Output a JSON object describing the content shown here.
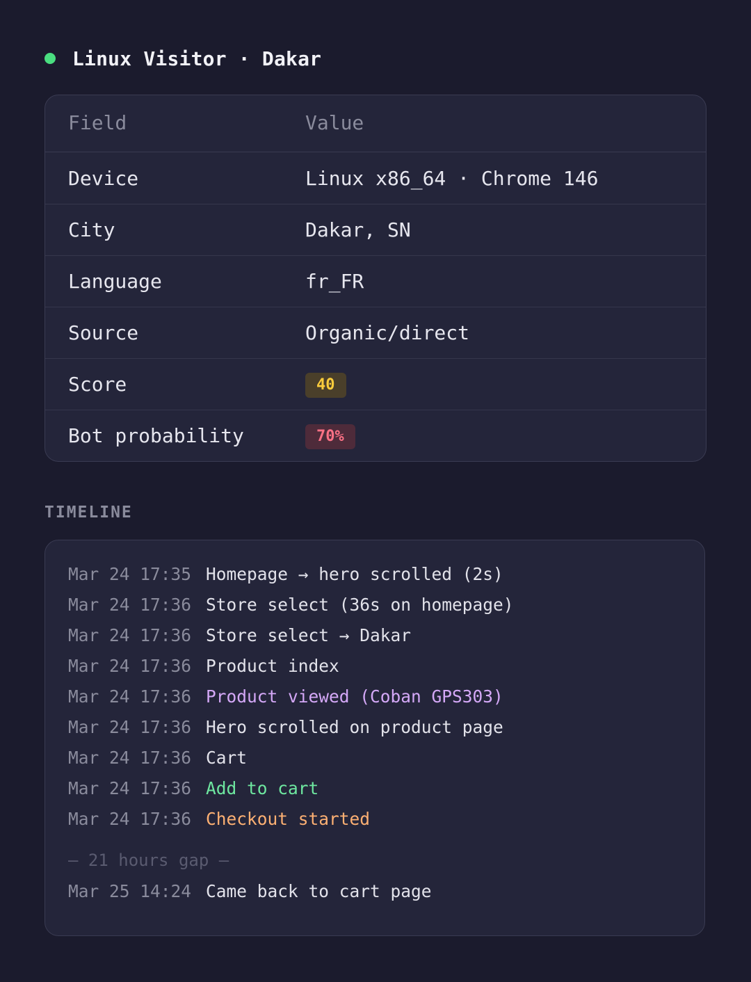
{
  "header": {
    "title": "Linux Visitor · Dakar",
    "status_color": "#4ade80"
  },
  "details": {
    "columns": [
      "Field",
      "Value"
    ],
    "rows": [
      {
        "field": "Device",
        "value": "Linux x86_64 · Chrome 146"
      },
      {
        "field": "City",
        "value": "Dakar, SN"
      },
      {
        "field": "Language",
        "value": "fr_FR"
      },
      {
        "field": "Source",
        "value": "Organic/direct"
      },
      {
        "field": "Score",
        "value": "40"
      },
      {
        "field": "Bot probability",
        "value": "70%"
      }
    ]
  },
  "timeline": {
    "label": "TIMELINE",
    "events": [
      {
        "time": "Mar 24 17:35",
        "text": "Homepage → hero scrolled (2s)"
      },
      {
        "time": "Mar 24 17:36",
        "text": "Store select (36s on homepage)"
      },
      {
        "time": "Mar 24 17:36",
        "text": "Store select → Dakar"
      },
      {
        "time": "Mar 24 17:36",
        "text": "Product index"
      },
      {
        "time": "Mar 24 17:36",
        "text": "Product viewed (Coban GPS303)"
      },
      {
        "time": "Mar 24 17:36",
        "text": "Hero scrolled on product page"
      },
      {
        "time": "Mar 24 17:36",
        "text": "Cart"
      },
      {
        "time": "Mar 24 17:36",
        "text": "Add to cart"
      },
      {
        "time": "Mar 24 17:36",
        "text": "Checkout started"
      }
    ],
    "gap_label": "— 21 hours gap —",
    "after_gap": [
      {
        "time": "Mar 25 14:24",
        "text": "Came back to cart page"
      }
    ]
  }
}
